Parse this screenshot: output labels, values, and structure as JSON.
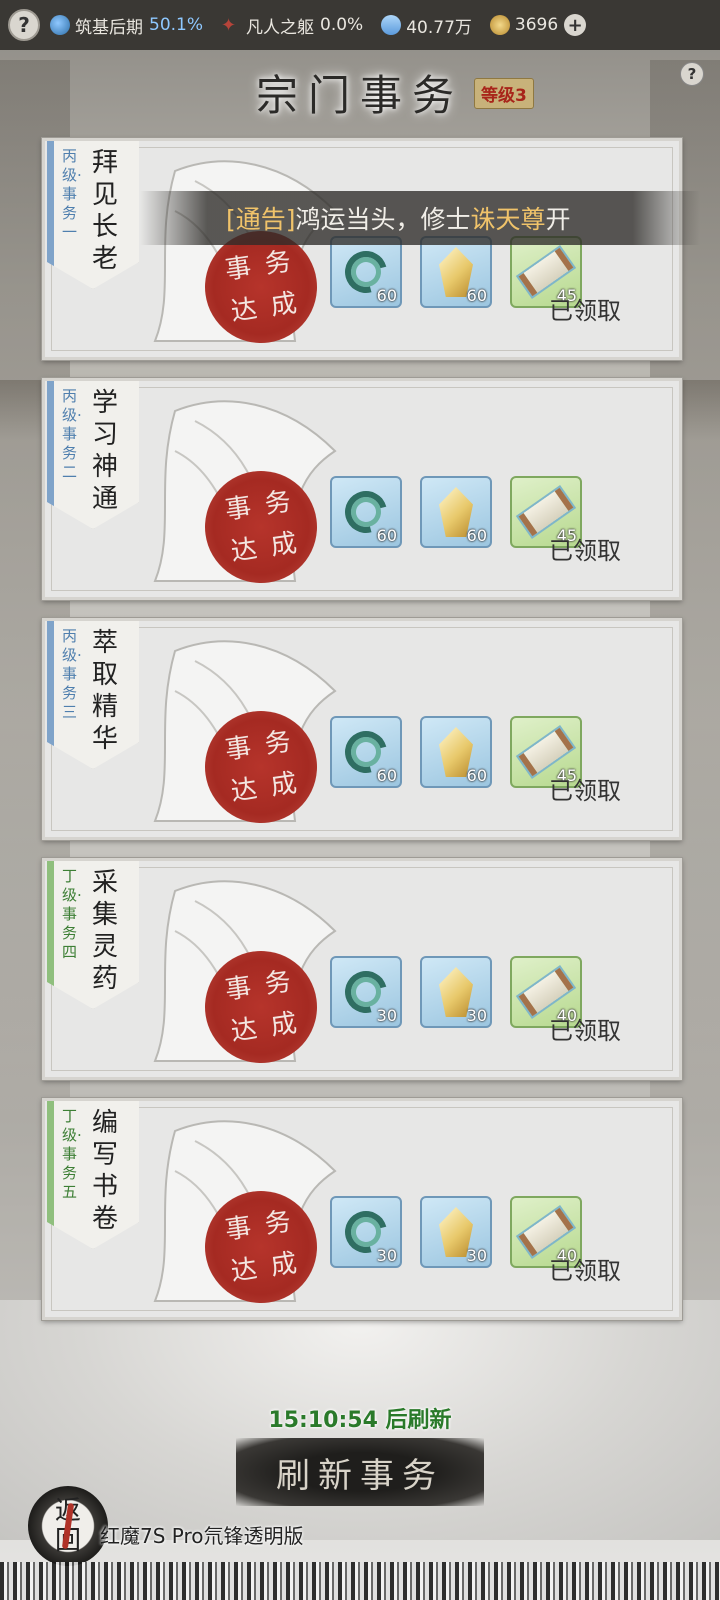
{
  "topbar": {
    "realm_name": "筑基后期",
    "realm_progress": "50.1%",
    "body_name": "凡人之躯",
    "body_progress": "0.0%",
    "spirit_stones": "40.77万",
    "coins": "3696",
    "help": "?",
    "plus": "+"
  },
  "header": {
    "title": "宗门事务",
    "level_badge": "等级3",
    "help": "?"
  },
  "announcement": {
    "tag": "[通告]",
    "text_prefix": "鸿运当头，修士",
    "highlight": "诛天尊",
    "text_suffix": "开"
  },
  "tasks": [
    {
      "grade": "丙级·事务一",
      "name": "拜见长老",
      "stamp": [
        "事",
        "务",
        "达",
        "成"
      ],
      "rewards": [
        {
          "icon": "talisman-icon",
          "qty": "60"
        },
        {
          "icon": "crystal-icon",
          "qty": "60"
        },
        {
          "icon": "scroll-icon",
          "qty": "45"
        }
      ],
      "status": "已领取"
    },
    {
      "grade": "丙级·事务二",
      "name": "学习神通",
      "stamp": [
        "事",
        "务",
        "达",
        "成"
      ],
      "rewards": [
        {
          "icon": "talisman-icon",
          "qty": "60"
        },
        {
          "icon": "crystal-icon",
          "qty": "60"
        },
        {
          "icon": "scroll-icon",
          "qty": "45"
        }
      ],
      "status": "已领取"
    },
    {
      "grade": "丙级·事务三",
      "name": "萃取精华",
      "stamp": [
        "事",
        "务",
        "达",
        "成"
      ],
      "rewards": [
        {
          "icon": "talisman-icon",
          "qty": "60"
        },
        {
          "icon": "crystal-icon",
          "qty": "60"
        },
        {
          "icon": "scroll-icon",
          "qty": "45"
        }
      ],
      "status": "已领取"
    },
    {
      "grade": "丁级·事务四",
      "name": "采集灵药",
      "stamp": [
        "事",
        "务",
        "达",
        "成"
      ],
      "rewards": [
        {
          "icon": "talisman-icon",
          "qty": "30"
        },
        {
          "icon": "crystal-icon",
          "qty": "30"
        },
        {
          "icon": "scroll-icon",
          "qty": "40"
        }
      ],
      "status": "已领取"
    },
    {
      "grade": "丁级·事务五",
      "name": "编写书卷",
      "stamp": [
        "事",
        "务",
        "达",
        "成"
      ],
      "rewards": [
        {
          "icon": "talisman-icon",
          "qty": "30"
        },
        {
          "icon": "crystal-icon",
          "qty": "30"
        },
        {
          "icon": "scroll-icon",
          "qty": "40"
        }
      ],
      "status": "已领取"
    }
  ],
  "refresh": {
    "timer": "15:10:54 后刷新",
    "button_label": "刷新事务"
  },
  "back_button": {
    "label_top": "返",
    "label_bottom": "回"
  },
  "device_label": "红魔7S Pro氘锋透明版",
  "colors": {
    "grade_c_accent": "#7fa3c9",
    "grade_d_accent": "#8fbf7d",
    "stamp_red": "#a52a22",
    "announce_highlight": "#f0c36a",
    "timer_green": "#2a7a2a"
  }
}
